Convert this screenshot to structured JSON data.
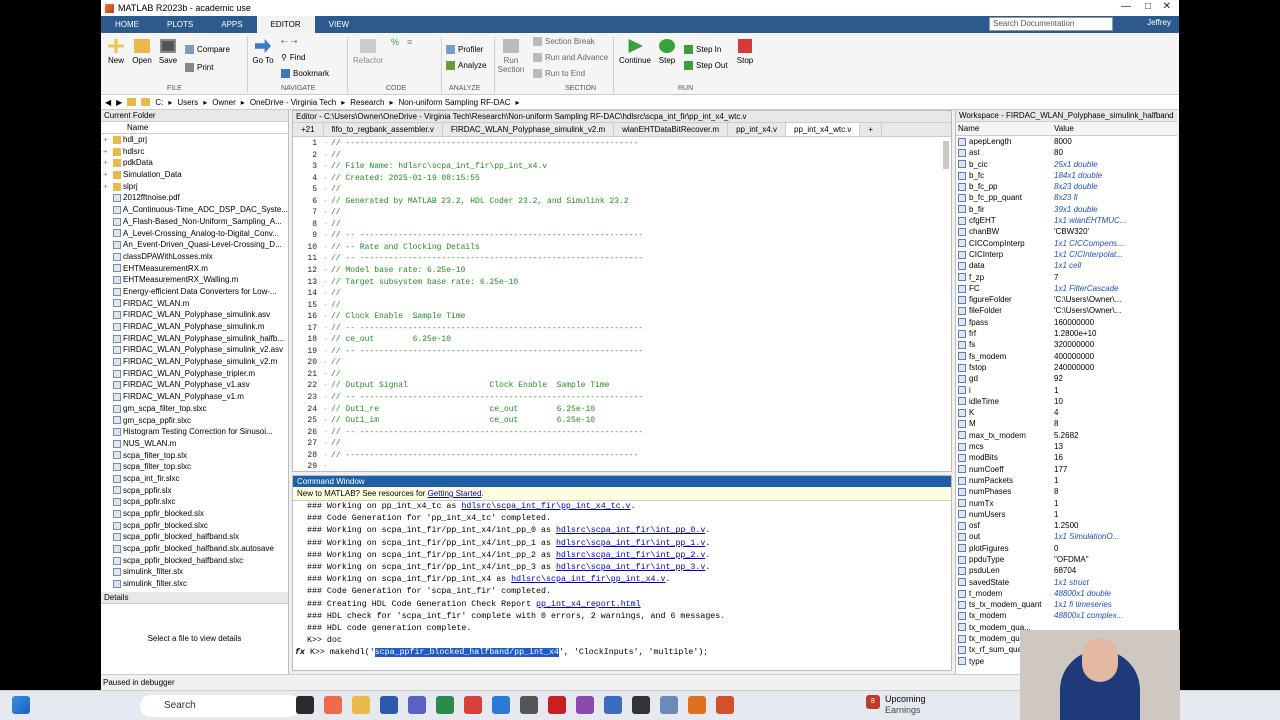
{
  "window": {
    "title": "MATLAB R2023b - academic use"
  },
  "ribbon_tabs": [
    "HOME",
    "PLOTS",
    "APPS",
    "EDITOR",
    "VIEW"
  ],
  "search_placeholder": "Search Documentation",
  "user": "Jeffrey",
  "toolbar": {
    "new": "New",
    "open": "Open",
    "save": "Save",
    "compare": "Compare",
    "print": "Print",
    "goto": "Go To",
    "find": "Find",
    "bookmark": "Bookmark",
    "refactor": "Refactor",
    "profiler": "Profiler",
    "analyze": "Analyze",
    "run_section": "Run Section",
    "section_break": "Section Break",
    "run_and_advance": "Run and Advance",
    "run_to_end": "Run to End",
    "continue": "Continue",
    "step": "Step",
    "step_in": "Step In",
    "step_out": "Step Out",
    "stop": "Stop",
    "groups": [
      "FILE",
      "NAVIGATE",
      "CODE",
      "ANALYZE",
      "SECTION",
      "RUN"
    ]
  },
  "address": {
    "drive": "C:",
    "crumbs": [
      "Users",
      "Owner",
      "OneDrive - Virginia Tech",
      "Research",
      "Non-uniform Sampling RF-DAC"
    ]
  },
  "current_folder": {
    "title": "Current Folder",
    "col_name": "Name",
    "folders": [
      "hdl_prj",
      "hdlsrc",
      "pdkData",
      "Simulation_Data",
      "slprj"
    ],
    "files": [
      "2012fftnoise.pdf",
      "A_Continuous-Time_ADC_DSP_DAC_Syste...",
      "A_Flash-Based_Non-Uniform_Sampling_A...",
      "A_Level-Crossing_Analog-to-Digital_Conv...",
      "An_Event-Driven_Quasi-Level-Crossing_D...",
      "classDPAWithLosses.mlx",
      "EHTMeasurementRX.m",
      "EHTMeasurementRX_Walling.m",
      "Energy-efficient Data Converters for Low-...",
      "FIRDAC_WLAN.m",
      "FIRDAC_WLAN_Polyphase_simulink.asv",
      "FIRDAC_WLAN_Polyphase_simulink.m",
      "FIRDAC_WLAN_Polyphase_simulink_halfb...",
      "FIRDAC_WLAN_Polyphase_simulink_v2.asv",
      "FIRDAC_WLAN_Polyphase_simulink_v2.m",
      "FIRDAC_WLAN_Polyphase_tripler.m",
      "FIRDAC_WLAN_Polyphase_v1.asv",
      "FIRDAC_WLAN_Polyphase_v1.m",
      "gm_scpa_filter_top.slxc",
      "gm_scpa_ppfir.slxc",
      "Histogram Testing Correction for Sinusoi...",
      "NUS_WLAN.m",
      "scpa_filter_top.slx",
      "scpa_filter_top.slxc",
      "scpa_int_fir.slxc",
      "scpa_ppfir.slx",
      "scpa_ppfir.slxc",
      "scpa_ppfir_blocked.slx",
      "scpa_ppfir_blocked.slxc",
      "scpa_ppfir_blocked_halfband.slx",
      "scpa_ppfir_blocked_halfband.slx.autosave",
      "scpa_ppfir_blocked_halfband.slxc",
      "simulink_filter.slx",
      "simulink_filter.slxc"
    ],
    "details_title": "Details",
    "details_text": "Select a file to view details"
  },
  "editor": {
    "title": "Editor - C:\\Users\\Owner\\OneDrive - Virginia Tech\\Research\\Non-uniform Sampling RF-DAC\\hdlsrc\\scpa_int_fir\\pp_int_x4_wtc.v",
    "tab_more": "+21",
    "tabs": [
      "fifo_to_regbank_assembler.v",
      "FIRDAC_WLAN_Polyphase_simulink_v2.m",
      "wlanEHTDataBitRecover.m",
      "pp_int_x4.v",
      "pp_int_x4_wtc.v"
    ],
    "lines": [
      {
        "n": "1",
        "t": "// -------------------------------------------------------------"
      },
      {
        "n": "2",
        "t": "//"
      },
      {
        "n": "3",
        "t": "// File Name: hdlsrc\\scpa_int_fir\\pp_int_x4.v"
      },
      {
        "n": "4",
        "t": "// Created: 2025-01-19 08:15:55"
      },
      {
        "n": "5",
        "t": "//"
      },
      {
        "n": "6",
        "t": "// Generated by MATLAB 23.2, HDL Coder 23.2, and Simulink 23.2"
      },
      {
        "n": "7",
        "t": "//"
      },
      {
        "n": "8",
        "t": "//"
      },
      {
        "n": "9",
        "t": "// -- -----------------------------------------------------------"
      },
      {
        "n": "10",
        "t": "// -- Rate and Clocking Details"
      },
      {
        "n": "11",
        "t": "// -- -----------------------------------------------------------"
      },
      {
        "n": "12",
        "t": "// Model base rate: 6.25e-10"
      },
      {
        "n": "13",
        "t": "// Target subsystem base rate: 6.25e-10"
      },
      {
        "n": "14",
        "t": "//"
      },
      {
        "n": "15",
        "t": "//"
      },
      {
        "n": "16",
        "t": "// Clock Enable  Sample Time"
      },
      {
        "n": "17",
        "t": "// -- -----------------------------------------------------------"
      },
      {
        "n": "18",
        "t": "// ce_out        6.25e-10"
      },
      {
        "n": "19",
        "t": "// -- -----------------------------------------------------------"
      },
      {
        "n": "20",
        "t": "//"
      },
      {
        "n": "21",
        "t": "//"
      },
      {
        "n": "22",
        "t": "// Output Signal                 Clock Enable  Sample Time"
      },
      {
        "n": "23",
        "t": "// -- -----------------------------------------------------------"
      },
      {
        "n": "24",
        "t": "// Out1_re                       ce_out        6.25e-10"
      },
      {
        "n": "25",
        "t": "// Out1_im                       ce_out        6.25e-10"
      },
      {
        "n": "26",
        "t": "// -- -----------------------------------------------------------"
      },
      {
        "n": "27",
        "t": "//"
      },
      {
        "n": "28",
        "t": "// -------------------------------------------------------------"
      },
      {
        "n": "29",
        "t": ""
      }
    ]
  },
  "command_window": {
    "title": "Command Window",
    "banner_pre": "New to MATLAB? See resources for ",
    "banner_link": "Getting Started",
    "banner_post": ".",
    "lines": [
      {
        "pre": "### Working on pp_int_x4_tc as ",
        "link": "hdlsrc\\scpa_int_fir\\pp_int_x4_tc.v",
        "post": "."
      },
      {
        "pre": "### Code Generation for 'pp_int_x4_tc' completed.",
        "link": "",
        "post": ""
      },
      {
        "pre": "### Working on scpa_int_fir/pp_int_x4/int_pp_0 as ",
        "link": "hdlsrc\\scpa_int_fir\\int_pp_0.v",
        "post": "."
      },
      {
        "pre": "### Working on scpa_int_fir/pp_int_x4/int_pp_1 as ",
        "link": "hdlsrc\\scpa_int_fir\\int_pp_1.v",
        "post": "."
      },
      {
        "pre": "### Working on scpa_int_fir/pp_int_x4/int_pp_2 as ",
        "link": "hdlsrc\\scpa_int_fir\\int_pp_2.v",
        "post": "."
      },
      {
        "pre": "### Working on scpa_int_fir/pp_int_x4/int_pp_3 as ",
        "link": "hdlsrc\\scpa_int_fir\\int_pp_3.v",
        "post": "."
      },
      {
        "pre": "### Working on scpa_int_fir/pp_int_x4 as ",
        "link": "hdlsrc\\scpa_int_fir\\pp_int_x4.v",
        "post": "."
      },
      {
        "pre": "### Code Generation for 'scpa_int_fir' completed.",
        "link": "",
        "post": ""
      },
      {
        "pre": "### Creating HDL Code Generation Check Report ",
        "link": "pp_int_x4_report.html",
        "post": ""
      },
      {
        "pre": "### HDL check for 'scpa_int_fir' complete with 0 errors, 2 warnings, and 6 messages.",
        "link": "",
        "post": ""
      },
      {
        "pre": "### HDL code generation complete.",
        "link": "",
        "post": ""
      },
      {
        "pre": "K>> doc",
        "link": "",
        "post": ""
      }
    ],
    "prompt": "K>> makehdl('",
    "selected": "scpa_ppfir_blocked_halfband/pp_int_x4",
    "prompt_post": "', 'ClockInputs', 'multiple');"
  },
  "workspace": {
    "title": "Workspace - FIRDAC_WLAN_Polyphase_simulink_halfband",
    "col_name": "Name",
    "col_value": "Value",
    "vars": [
      {
        "n": "apepLength",
        "v": "8000",
        "i": false
      },
      {
        "n": "ast",
        "v": "80",
        "i": false
      },
      {
        "n": "b_cic",
        "v": "25x1 double",
        "i": true
      },
      {
        "n": "b_fc",
        "v": "184x1 double",
        "i": true
      },
      {
        "n": "b_fc_pp",
        "v": "8x23 double",
        "i": true
      },
      {
        "n": "b_fc_pp_quant",
        "v": "8x23 fi",
        "i": true
      },
      {
        "n": "b_fir",
        "v": "39x1 double",
        "i": true
      },
      {
        "n": "cfgEHT",
        "v": "1x1 wlanEHTMUC...",
        "i": true
      },
      {
        "n": "chanBW",
        "v": "'CBW320'",
        "i": false
      },
      {
        "n": "CICCompInterp",
        "v": "1x1 CICCompens...",
        "i": true
      },
      {
        "n": "CICInterp",
        "v": "1x1 CICInterpolat...",
        "i": true
      },
      {
        "n": "data",
        "v": "1x1 cell",
        "i": true
      },
      {
        "n": "f_zp",
        "v": "7",
        "i": false
      },
      {
        "n": "FC",
        "v": "1x1 FilterCascade",
        "i": true
      },
      {
        "n": "figureFolder",
        "v": "'C:\\Users\\Owner\\...",
        "i": false
      },
      {
        "n": "fileFolder",
        "v": "'C:\\Users\\Owner\\...",
        "i": false
      },
      {
        "n": "fpass",
        "v": "160000000",
        "i": false
      },
      {
        "n": "frf",
        "v": "1.2800e+10",
        "i": false
      },
      {
        "n": "fs",
        "v": "320000000",
        "i": false
      },
      {
        "n": "fs_modem",
        "v": "400000000",
        "i": false
      },
      {
        "n": "fstop",
        "v": "240000000",
        "i": false
      },
      {
        "n": "gd",
        "v": "92",
        "i": false
      },
      {
        "n": "i",
        "v": "1",
        "i": false
      },
      {
        "n": "idleTime",
        "v": "10",
        "i": false
      },
      {
        "n": "K",
        "v": "4",
        "i": false
      },
      {
        "n": "M",
        "v": "8",
        "i": false
      },
      {
        "n": "max_tx_modem",
        "v": "5.2682",
        "i": false
      },
      {
        "n": "mcs",
        "v": "13",
        "i": false
      },
      {
        "n": "modBits",
        "v": "16",
        "i": false
      },
      {
        "n": "numCoeff",
        "v": "177",
        "i": false
      },
      {
        "n": "numPackets",
        "v": "1",
        "i": false
      },
      {
        "n": "numPhases",
        "v": "8",
        "i": false
      },
      {
        "n": "numTx",
        "v": "1",
        "i": false
      },
      {
        "n": "numUsers",
        "v": "1",
        "i": false
      },
      {
        "n": "osf",
        "v": "1.2500",
        "i": false
      },
      {
        "n": "out",
        "v": "1x1 SimulationO...",
        "i": true
      },
      {
        "n": "plotFigures",
        "v": "0",
        "i": false
      },
      {
        "n": "ppduType",
        "v": "\"OFDMA\"",
        "i": false
      },
      {
        "n": "psduLen",
        "v": "68704",
        "i": false
      },
      {
        "n": "savedState",
        "v": "1x1 struct",
        "i": true
      },
      {
        "n": "t_modem",
        "v": "48800x1 double",
        "i": true
      },
      {
        "n": "ts_tx_modem_quant",
        "v": "1x1 fi timeseries",
        "i": true
      },
      {
        "n": "tx_modem",
        "v": "48800x1 complex...",
        "i": true
      },
      {
        "n": "tx_modem_qua...",
        "v": "",
        "i": false
      },
      {
        "n": "tx_modem_qua...",
        "v": "",
        "i": false
      },
      {
        "n": "tx_rf_sum_quant",
        "v": "",
        "i": false
      },
      {
        "n": "type",
        "v": "",
        "i": false
      }
    ]
  },
  "status": "Paused in debugger",
  "taskbar": {
    "search": "Search",
    "upcoming_title": "Upcoming",
    "upcoming_sub": "Earnings",
    "badge": "8"
  },
  "colors": {
    "accent": "#2c5a8c",
    "cmd_header": "#1f5fa6",
    "comment": "#228b22",
    "link": "#0000cc",
    "selection": "#1e5bc6"
  }
}
